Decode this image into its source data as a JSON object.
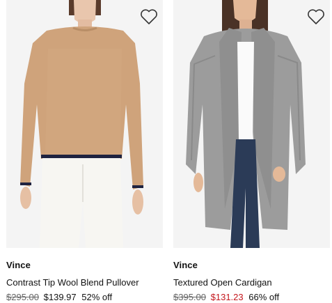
{
  "colors": {
    "sale_red": "#c4161c",
    "strike_gray": "#666666"
  },
  "products": [
    {
      "brand": "Vince",
      "name": "Contrast Tip Wool Blend Pullover",
      "original_price": "$295.00",
      "sale_price": "$139.97",
      "discount": "52% off",
      "favorite_icon": "heart-outline-icon"
    },
    {
      "brand": "Vince",
      "name": "Textured Open Cardigan",
      "original_price": "$395.00",
      "sale_price": "$131.23",
      "discount": "66% off",
      "favorite_icon": "heart-outline-icon"
    }
  ]
}
